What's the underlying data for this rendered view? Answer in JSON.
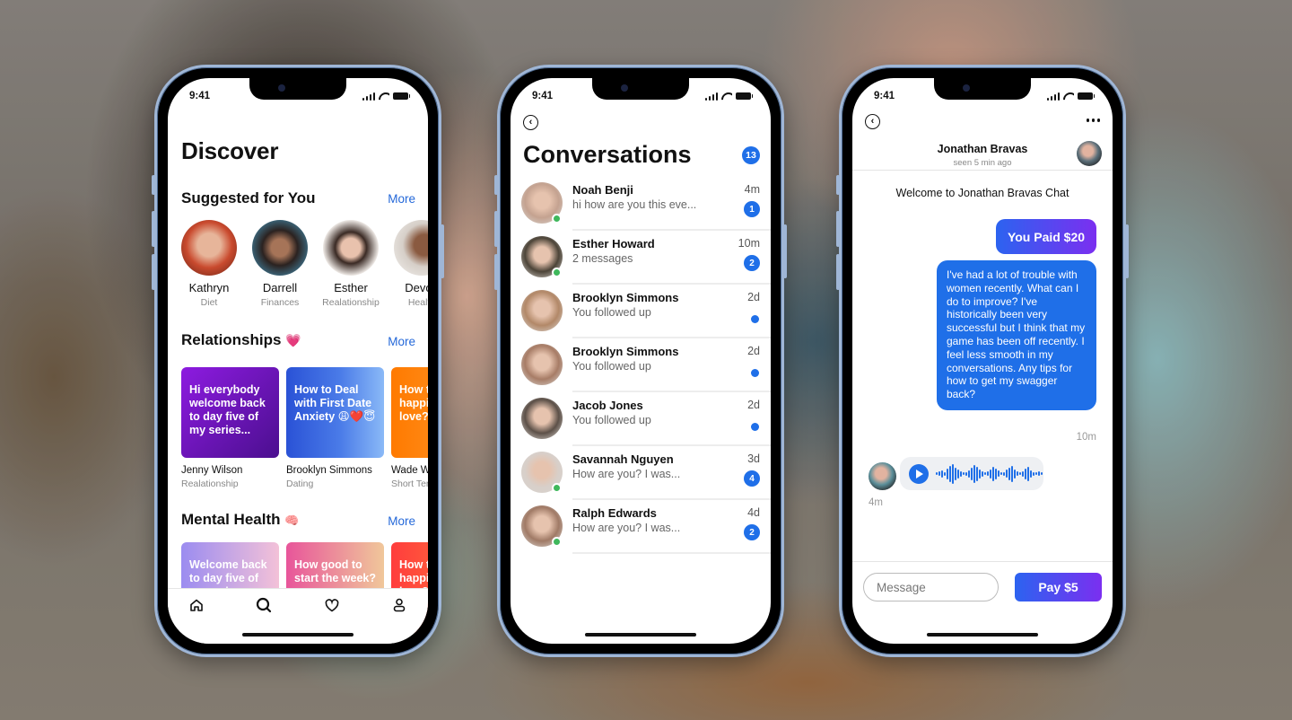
{
  "status_bar": {
    "time": "9:41"
  },
  "discover": {
    "title": "Discover",
    "suggested": {
      "title": "Suggested for You",
      "more_label": "More",
      "people": [
        {
          "name": "Kathryn",
          "category": "Diet",
          "color": "#c94a2e"
        },
        {
          "name": "Darrell",
          "category": "Finances",
          "color": "#3c6a80"
        },
        {
          "name": "Esther",
          "category": "Realationship",
          "color": "#d9cfc8"
        },
        {
          "name": "Devon",
          "category": "Health",
          "color": "#b08a70"
        }
      ]
    },
    "relationships": {
      "title": "Relationships",
      "emoji": "💗",
      "more_label": "More",
      "cards": [
        {
          "text": "Hi everybody welcome back to day five of my series...",
          "author": "Jenny Wilson",
          "category": "Realationship",
          "gradient": [
            "#8d1be0",
            "#4b0f8f"
          ]
        },
        {
          "text": "How to Deal with First Date Anxiety 😩❤️😇",
          "author": "Brooklyn Simmons",
          "category": "Dating",
          "gradient": [
            "#2a52d6",
            "#7fb4f5"
          ]
        },
        {
          "text": "How to find happiness in love?",
          "author": "Wade Warren",
          "category": "Short Term",
          "gradient": [
            "#ff7a00",
            "#ff9a2e"
          ]
        }
      ]
    },
    "mental_health": {
      "title": "Mental Health",
      "emoji": "🧠",
      "more_label": "More",
      "cards": [
        {
          "text": "Welcome back to day five of my series...",
          "gradient": [
            "#9b8cf0",
            "#f3c1d8"
          ]
        },
        {
          "text": "How good to start the week?",
          "gradient": [
            "#e8559a",
            "#f0c79a"
          ]
        },
        {
          "text": "How to find happiness in love?",
          "gradient": [
            "#ff3d3d",
            "#ff7a3a"
          ]
        }
      ]
    },
    "tabbar": [
      {
        "name": "home",
        "icon": "home-icon"
      },
      {
        "name": "search",
        "icon": "search-icon"
      },
      {
        "name": "favorites",
        "icon": "heart-icon"
      },
      {
        "name": "profile",
        "icon": "user-icon"
      }
    ]
  },
  "conversations": {
    "title": "Conversations",
    "total_unread": "13",
    "items": [
      {
        "name": "Noah Benji",
        "preview": "hi how are you this eve...",
        "time": "4m",
        "unread": "1",
        "online": true,
        "color": "#c4a290"
      },
      {
        "name": "Esther Howard",
        "preview": "2 messages",
        "time": "10m",
        "unread": "2",
        "online": true,
        "color": "#4c4438"
      },
      {
        "name": "Brooklyn Simmons",
        "preview": "You followed up",
        "time": "2d",
        "unread": "",
        "online": false,
        "color": "#b28868"
      },
      {
        "name": "Brooklyn Simmons",
        "preview": "You followed up",
        "time": "2d",
        "unread": "",
        "online": false,
        "color": "#a77c66"
      },
      {
        "name": "Jacob Jones",
        "preview": "You followed up",
        "time": "2d",
        "unread": "",
        "online": false,
        "color": "#5c5048"
      },
      {
        "name": "Savannah Nguyen",
        "preview": "How are you? I was...",
        "time": "3d",
        "unread": "4",
        "online": true,
        "color": "#d8cfc9"
      },
      {
        "name": "Ralph Edwards",
        "preview": "How are you? I was...",
        "time": "4d",
        "unread": "2",
        "online": true,
        "color": "#a07a66"
      }
    ]
  },
  "chat": {
    "contact_name": "Jonathan Bravas",
    "seen": "seen 5 min ago",
    "welcome": "Welcome to Jonathan Bravas Chat",
    "payment_label": "You Paid $20",
    "message": "I've had a lot of trouble with women recently. What can I do to improve? I've historically been very successful but I think that my game has been off recently. I feel less smooth in my conversations. Any tips for how to get my swagger back?",
    "message_time": "10m",
    "voice_time": "4m",
    "input_placeholder": "Message",
    "pay_label": "Pay $5"
  }
}
